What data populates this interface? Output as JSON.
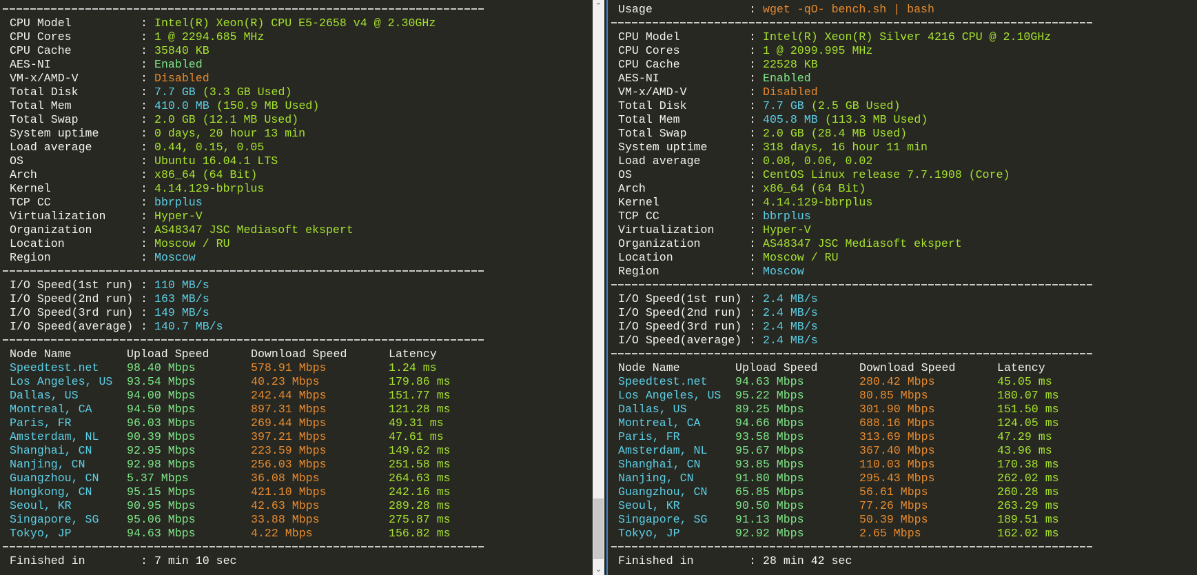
{
  "colors": {
    "label": "#f2f2ee",
    "yellowgreen": "#a6e22e",
    "green": "#7ee787",
    "cyan": "#5ccfe6",
    "orange": "#e88a2e"
  },
  "left": {
    "info": [
      {
        "label": "CPU Model",
        "parts": [
          {
            "text": "Intel(R) Xeon(R) CPU E5-2658 v4 @ 2.30GHz",
            "color": "#a6e22e"
          }
        ]
      },
      {
        "label": "CPU Cores",
        "parts": [
          {
            "text": "1 @ 2294.685 MHz",
            "color": "#a6e22e"
          }
        ]
      },
      {
        "label": "CPU Cache",
        "parts": [
          {
            "text": "35840 KB",
            "color": "#a6e22e"
          }
        ]
      },
      {
        "label": "AES-NI",
        "parts": [
          {
            "text": "Enabled",
            "color": "#7ee787"
          }
        ]
      },
      {
        "label": "VM-x/AMD-V",
        "parts": [
          {
            "text": "Disabled",
            "color": "#e88a2e"
          }
        ]
      },
      {
        "label": "Total Disk",
        "parts": [
          {
            "text": "7.7 GB",
            "color": "#5ccfe6"
          },
          {
            "text": " (3.3 GB Used)",
            "color": "#a6e22e"
          }
        ]
      },
      {
        "label": "Total Mem",
        "parts": [
          {
            "text": "410.0 MB",
            "color": "#5ccfe6"
          },
          {
            "text": " (150.9 MB Used)",
            "color": "#a6e22e"
          }
        ]
      },
      {
        "label": "Total Swap",
        "parts": [
          {
            "text": "2.0 GB (12.1 MB Used)",
            "color": "#a6e22e"
          }
        ]
      },
      {
        "label": "System uptime",
        "parts": [
          {
            "text": "0 days, 20 hour 13 min",
            "color": "#a6e22e"
          }
        ]
      },
      {
        "label": "Load average",
        "parts": [
          {
            "text": "0.44, 0.15, 0.05",
            "color": "#a6e22e"
          }
        ]
      },
      {
        "label": "OS",
        "parts": [
          {
            "text": "Ubuntu 16.04.1 LTS",
            "color": "#a6e22e"
          }
        ]
      },
      {
        "label": "Arch",
        "parts": [
          {
            "text": "x86_64 (64 Bit)",
            "color": "#a6e22e"
          }
        ]
      },
      {
        "label": "Kernel",
        "parts": [
          {
            "text": "4.14.129-bbrplus",
            "color": "#a6e22e"
          }
        ]
      },
      {
        "label": "TCP CC",
        "parts": [
          {
            "text": "bbrplus",
            "color": "#5ccfe6"
          }
        ]
      },
      {
        "label": "Virtualization",
        "parts": [
          {
            "text": "Hyper-V",
            "color": "#a6e22e"
          }
        ]
      },
      {
        "label": "Organization",
        "parts": [
          {
            "text": "AS48347 JSC Mediasoft ekspert",
            "color": "#a6e22e"
          }
        ]
      },
      {
        "label": "Location",
        "parts": [
          {
            "text": "Moscow / RU",
            "color": "#a6e22e"
          }
        ]
      },
      {
        "label": "Region",
        "parts": [
          {
            "text": "Moscow",
            "color": "#5ccfe6"
          }
        ]
      }
    ],
    "io": [
      {
        "label": "I/O Speed(1st run)",
        "value": "110 MB/s"
      },
      {
        "label": "I/O Speed(2nd run)",
        "value": "163 MB/s"
      },
      {
        "label": "I/O Speed(3rd run)",
        "value": "149 MB/s"
      },
      {
        "label": "I/O Speed(average)",
        "value": "140.7 MB/s"
      }
    ],
    "headers": [
      "Node Name",
      "Upload Speed",
      "Download Speed",
      "Latency"
    ],
    "nodes": [
      [
        "Speedtest.net",
        "98.40 Mbps",
        "578.91 Mbps",
        "1.24 ms"
      ],
      [
        "Los Angeles, US",
        "93.54 Mbps",
        "40.23 Mbps",
        "179.86 ms"
      ],
      [
        "Dallas, US",
        "94.00 Mbps",
        "242.44 Mbps",
        "151.77 ms"
      ],
      [
        "Montreal, CA",
        "94.50 Mbps",
        "897.31 Mbps",
        "121.28 ms"
      ],
      [
        "Paris, FR",
        "96.03 Mbps",
        "269.44 Mbps",
        "49.31 ms"
      ],
      [
        "Amsterdam, NL",
        "90.39 Mbps",
        "397.21 Mbps",
        "47.61 ms"
      ],
      [
        "Shanghai, CN",
        "92.95 Mbps",
        "223.59 Mbps",
        "149.62 ms"
      ],
      [
        "Nanjing, CN",
        "92.98 Mbps",
        "256.03 Mbps",
        "251.58 ms"
      ],
      [
        "Guangzhou, CN",
        "5.37 Mbps",
        "36.08 Mbps",
        "264.63 ms"
      ],
      [
        "Hongkong, CN",
        "95.15 Mbps",
        "421.10 Mbps",
        "242.16 ms"
      ],
      [
        "Seoul, KR",
        "90.95 Mbps",
        "42.63 Mbps",
        "289.28 ms"
      ],
      [
        "Singapore, SG",
        "95.06 Mbps",
        "33.88 Mbps",
        "275.87 ms"
      ],
      [
        "Tokyo, JP",
        "94.63 Mbps",
        "4.22 Mbps",
        "156.82 ms"
      ]
    ],
    "finished": {
      "label": "Finished in",
      "value": "7 min 10 sec"
    }
  },
  "right": {
    "usage": {
      "label": "Usage",
      "value": "wget -qO- bench.sh | bash"
    },
    "info": [
      {
        "label": "CPU Model",
        "parts": [
          {
            "text": "Intel(R) Xeon(R) Silver 4216 CPU @ 2.10GHz",
            "color": "#a6e22e"
          }
        ]
      },
      {
        "label": "CPU Cores",
        "parts": [
          {
            "text": "1 @ 2099.995 MHz",
            "color": "#a6e22e"
          }
        ]
      },
      {
        "label": "CPU Cache",
        "parts": [
          {
            "text": "22528 KB",
            "color": "#a6e22e"
          }
        ]
      },
      {
        "label": "AES-NI",
        "parts": [
          {
            "text": "Enabled",
            "color": "#7ee787"
          }
        ]
      },
      {
        "label": "VM-x/AMD-V",
        "parts": [
          {
            "text": "Disabled",
            "color": "#e88a2e"
          }
        ]
      },
      {
        "label": "Total Disk",
        "parts": [
          {
            "text": "7.7 GB",
            "color": "#5ccfe6"
          },
          {
            "text": " (2.5 GB Used)",
            "color": "#a6e22e"
          }
        ]
      },
      {
        "label": "Total Mem",
        "parts": [
          {
            "text": "405.8 MB",
            "color": "#5ccfe6"
          },
          {
            "text": " (113.3 MB Used)",
            "color": "#a6e22e"
          }
        ]
      },
      {
        "label": "Total Swap",
        "parts": [
          {
            "text": "2.0 GB (28.4 MB Used)",
            "color": "#a6e22e"
          }
        ]
      },
      {
        "label": "System uptime",
        "parts": [
          {
            "text": "318 days, 16 hour 11 min",
            "color": "#a6e22e"
          }
        ]
      },
      {
        "label": "Load average",
        "parts": [
          {
            "text": "0.08, 0.06, 0.02",
            "color": "#a6e22e"
          }
        ]
      },
      {
        "label": "OS",
        "parts": [
          {
            "text": "CentOS Linux release 7.7.1908 (Core)",
            "color": "#a6e22e"
          }
        ]
      },
      {
        "label": "Arch",
        "parts": [
          {
            "text": "x86_64 (64 Bit)",
            "color": "#a6e22e"
          }
        ]
      },
      {
        "label": "Kernel",
        "parts": [
          {
            "text": "4.14.129-bbrplus",
            "color": "#a6e22e"
          }
        ]
      },
      {
        "label": "TCP CC",
        "parts": [
          {
            "text": "bbrplus",
            "color": "#5ccfe6"
          }
        ]
      },
      {
        "label": "Virtualization",
        "parts": [
          {
            "text": "Hyper-V",
            "color": "#a6e22e"
          }
        ]
      },
      {
        "label": "Organization",
        "parts": [
          {
            "text": "AS48347 JSC Mediasoft ekspert",
            "color": "#a6e22e"
          }
        ]
      },
      {
        "label": "Location",
        "parts": [
          {
            "text": "Moscow / RU",
            "color": "#a6e22e"
          }
        ]
      },
      {
        "label": "Region",
        "parts": [
          {
            "text": "Moscow",
            "color": "#5ccfe6"
          }
        ]
      }
    ],
    "io": [
      {
        "label": "I/O Speed(1st run)",
        "value": "2.4 MB/s"
      },
      {
        "label": "I/O Speed(2nd run)",
        "value": "2.4 MB/s"
      },
      {
        "label": "I/O Speed(3rd run)",
        "value": "2.4 MB/s"
      },
      {
        "label": "I/O Speed(average)",
        "value": "2.4 MB/s"
      }
    ],
    "headers": [
      "Node Name",
      "Upload Speed",
      "Download Speed",
      "Latency"
    ],
    "nodes": [
      [
        "Speedtest.net",
        "94.63 Mbps",
        "280.42 Mbps",
        "45.05 ms"
      ],
      [
        "Los Angeles, US",
        "95.22 Mbps",
        "80.85 Mbps",
        "180.07 ms"
      ],
      [
        "Dallas, US",
        "89.25 Mbps",
        "301.90 Mbps",
        "151.50 ms"
      ],
      [
        "Montreal, CA",
        "94.66 Mbps",
        "688.16 Mbps",
        "124.05 ms"
      ],
      [
        "Paris, FR",
        "93.58 Mbps",
        "313.69 Mbps",
        "47.29 ms"
      ],
      [
        "Amsterdam, NL",
        "95.67 Mbps",
        "367.40 Mbps",
        "43.96 ms"
      ],
      [
        "Shanghai, CN",
        "93.85 Mbps",
        "110.03 Mbps",
        "170.38 ms"
      ],
      [
        "Nanjing, CN",
        "91.80 Mbps",
        "295.43 Mbps",
        "262.02 ms"
      ],
      [
        "Guangzhou, CN",
        "65.85 Mbps",
        "56.61 Mbps",
        "260.28 ms"
      ],
      [
        "Seoul, KR",
        "90.50 Mbps",
        "77.26 Mbps",
        "263.29 ms"
      ],
      [
        "Singapore, SG",
        "91.13 Mbps",
        "50.39 Mbps",
        "189.51 ms"
      ],
      [
        "Tokyo, JP",
        "92.92 Mbps",
        "2.65 Mbps",
        "162.02 ms"
      ]
    ],
    "finished": {
      "label": "Finished in",
      "value": "28 min 42 sec"
    }
  },
  "scrollbar": {
    "up_icon": "▲",
    "down_icon": "▼"
  }
}
